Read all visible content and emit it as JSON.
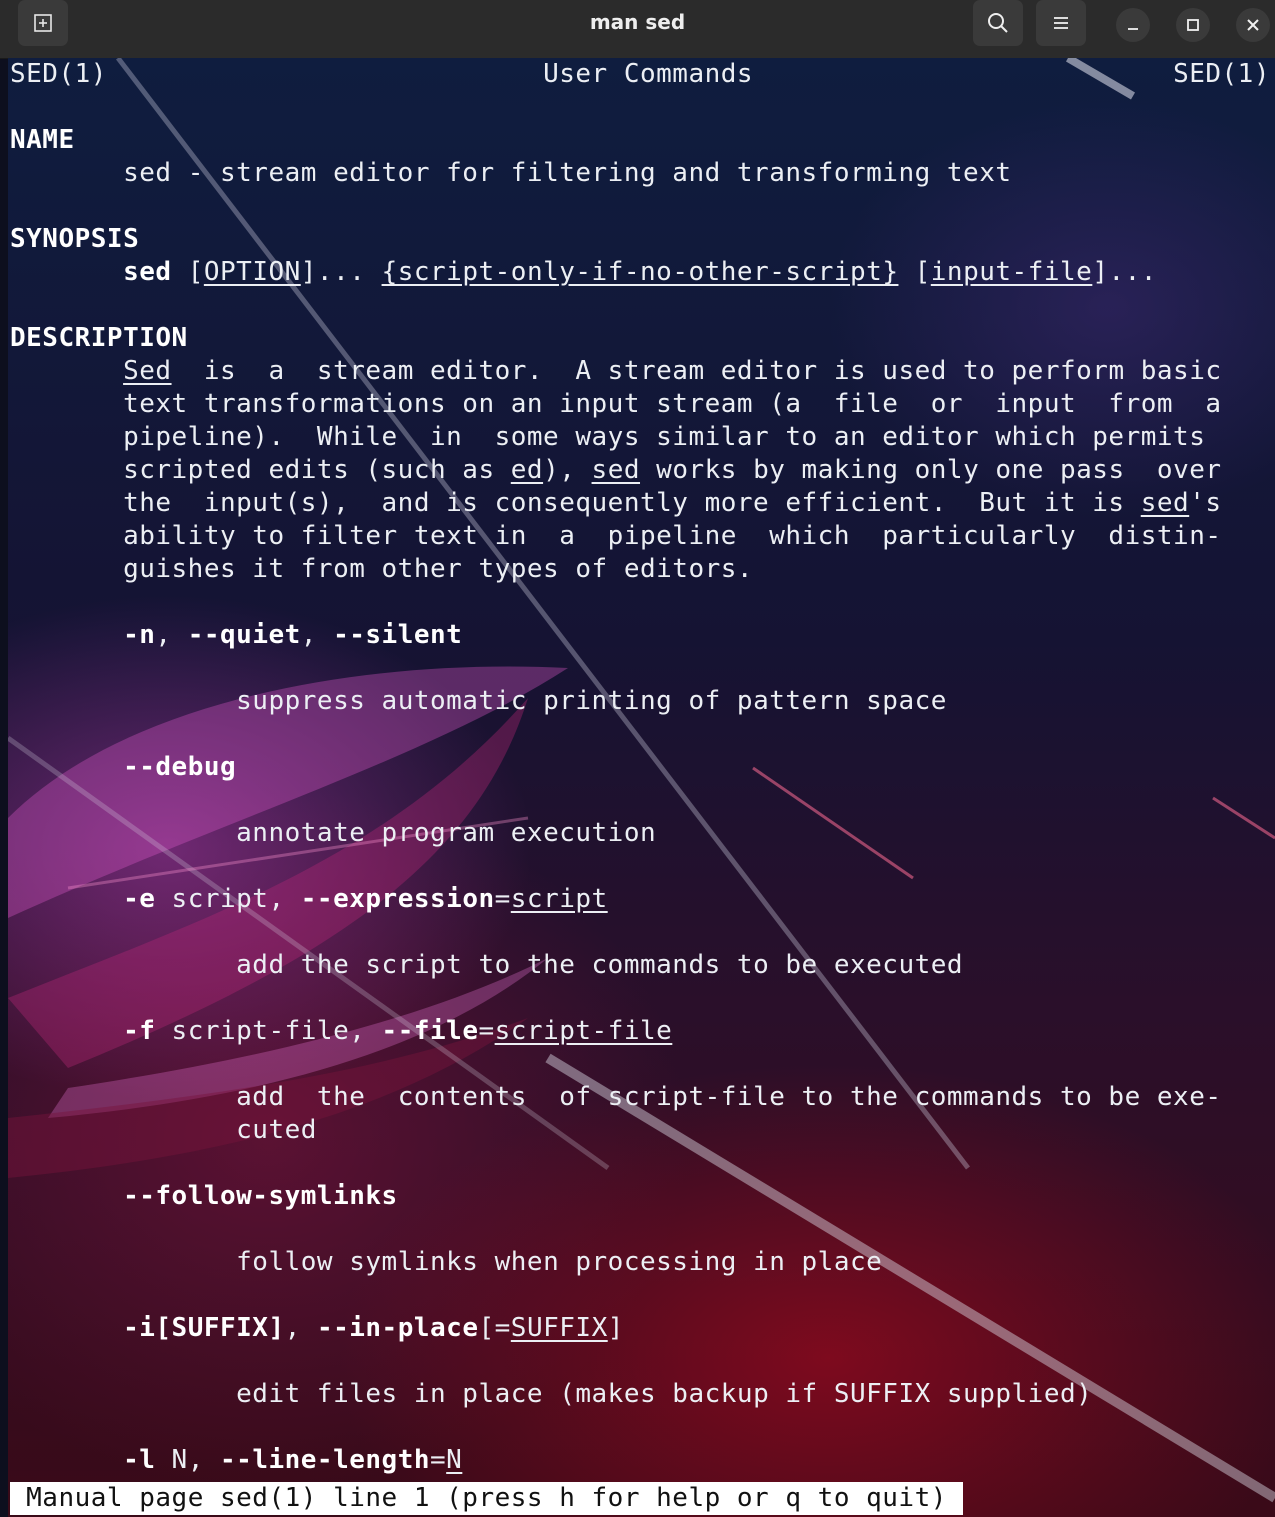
{
  "window": {
    "title": "man sed"
  },
  "titlebar_icons": {
    "new_tab": "new-tab-icon",
    "search": "search-icon",
    "menu": "hamburger-menu-icon",
    "minimize": "minimize-icon",
    "maximize": "maximize-icon",
    "close": "close-icon"
  },
  "man": {
    "header": {
      "left": "SED(1)",
      "center": "User Commands",
      "right": "SED(1)"
    },
    "sections": {
      "name_heading": "NAME",
      "name_text": "sed - stream editor for filtering and transforming text",
      "synopsis_heading": "SYNOPSIS",
      "synopsis": {
        "cmd": "sed",
        "option": "OPTION",
        "script": "{script-only-if-no-other-script}",
        "input_file": "input-file"
      },
      "description_heading": "DESCRIPTION"
    },
    "options": {
      "quiet_flags": "-n, --quiet, --silent",
      "quiet_desc": "suppress automatic printing of pattern space",
      "debug_flag": "--debug",
      "debug_desc": "annotate program execution",
      "expr_desc": "add the script to the commands to be executed",
      "file_desc_1": "add  the  contents  of script-file to the commands to be exe-",
      "file_desc_2": "cuted",
      "follow_flag": "--follow-symlinks",
      "follow_desc": "follow symlinks when processing in place",
      "inplace_desc": "edit files in place (makes backup if SUFFIX supplied)"
    },
    "status_line": "Manual page sed(1) line 1 (press h for help or q to quit)"
  }
}
